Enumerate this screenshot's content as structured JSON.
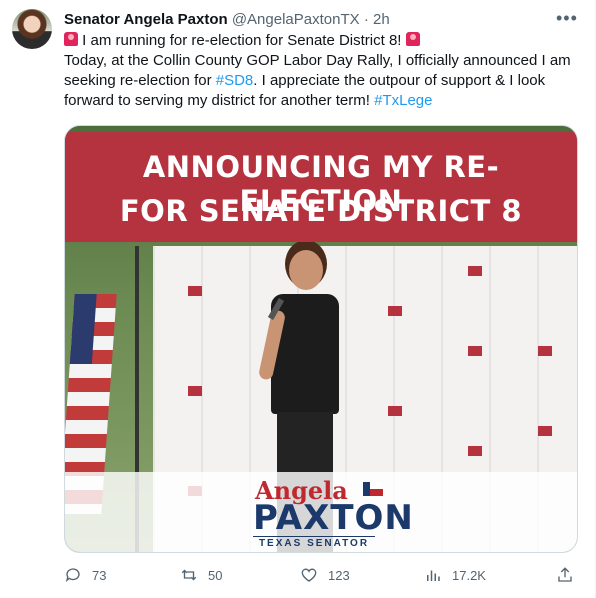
{
  "author": {
    "name": "Senator Angela Paxton",
    "handle": "@AngelaPaxtonTX",
    "dot": "·",
    "time": "2h"
  },
  "tweet": {
    "line1": "I am running for re-election for Senate District 8!",
    "line2a": "Today, at the Collin County GOP Labor Day Rally, I officially announced I am seeking re-election for ",
    "hashtag1": "#SD8",
    "line2b": ". I appreciate the outpour of support & I look forward to serving my district for another term! ",
    "hashtag2": "#TxLege"
  },
  "media": {
    "banner_line1": "ANNOUNCING MY RE-ELECTION",
    "banner_line2": "FOR SENATE DISTRICT 8",
    "logo_first": "Angela",
    "logo_last": "PAXTON",
    "logo_title": "TEXAS SENATOR"
  },
  "actions": {
    "replies": "73",
    "retweets": "50",
    "likes": "123",
    "views": "17.2K"
  },
  "colors": {
    "link": "#1d9bf0",
    "banner": "#b5333f",
    "muted": "#536471"
  }
}
